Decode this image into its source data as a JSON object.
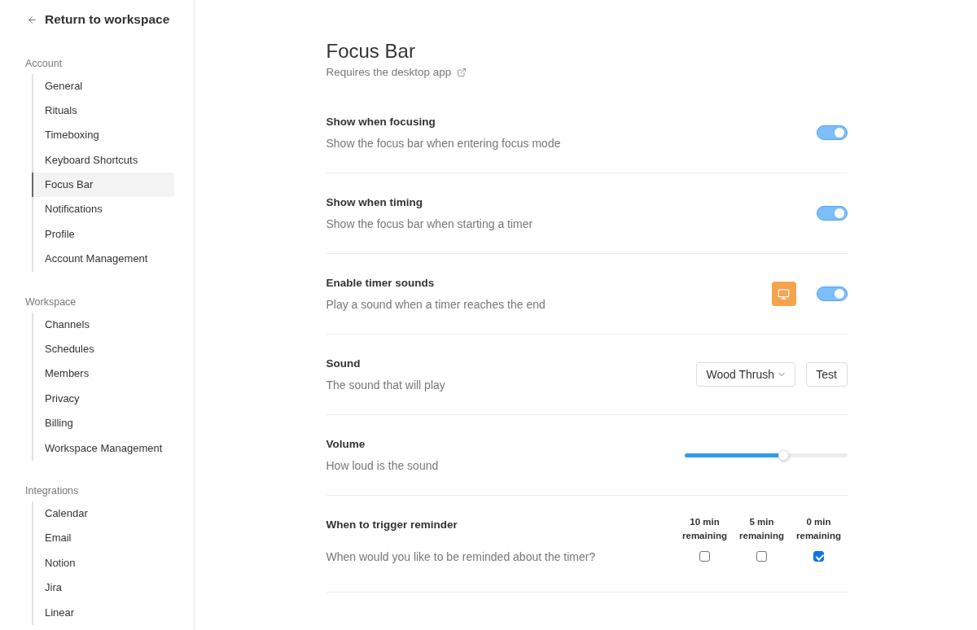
{
  "sidebar": {
    "back_link": "Return to workspace",
    "sections": [
      {
        "title": "Account",
        "items": [
          {
            "label": "General",
            "selected": false
          },
          {
            "label": "Rituals",
            "selected": false
          },
          {
            "label": "Timeboxing",
            "selected": false
          },
          {
            "label": "Keyboard Shortcuts",
            "selected": false
          },
          {
            "label": "Focus Bar",
            "selected": true
          },
          {
            "label": "Notifications",
            "selected": false
          },
          {
            "label": "Profile",
            "selected": false
          },
          {
            "label": "Account Management",
            "selected": false
          }
        ]
      },
      {
        "title": "Workspace",
        "items": [
          {
            "label": "Channels",
            "selected": false
          },
          {
            "label": "Schedules",
            "selected": false
          },
          {
            "label": "Members",
            "selected": false
          },
          {
            "label": "Privacy",
            "selected": false
          },
          {
            "label": "Billing",
            "selected": false
          },
          {
            "label": "Workspace Management",
            "selected": false
          }
        ]
      },
      {
        "title": "Integrations",
        "items": [
          {
            "label": "Calendar",
            "selected": false
          },
          {
            "label": "Email",
            "selected": false
          },
          {
            "label": "Notion",
            "selected": false
          },
          {
            "label": "Jira",
            "selected": false
          },
          {
            "label": "Linear",
            "selected": false
          }
        ]
      }
    ]
  },
  "page": {
    "title": "Focus Bar",
    "subtitle": "Requires the desktop app"
  },
  "settings": [
    {
      "kind": "toggle",
      "title": "Show when focusing",
      "description": "Show the focus bar when entering focus mode",
      "on": true
    },
    {
      "kind": "toggle",
      "title": "Show when timing",
      "description": "Show the focus bar when starting a timer",
      "on": true
    },
    {
      "kind": "toggle",
      "title": "Enable timer sounds",
      "description": "Play a sound when a timer reaches the end",
      "on": true,
      "desktop_badge": true
    },
    {
      "kind": "select",
      "title": "Sound",
      "description": "The sound that will play",
      "value": "Wood Thrush",
      "button": "Test"
    },
    {
      "kind": "slider",
      "title": "Volume",
      "description": "How loud is the sound",
      "level": 0.61
    },
    {
      "kind": "checkboxes",
      "title": "When to trigger reminder",
      "description": "When would you like to be reminded about the timer?",
      "options": [
        {
          "label": "10 min remaining",
          "checked": false
        },
        {
          "label": "5 min remaining",
          "checked": false
        },
        {
          "label": "0 min remaining",
          "checked": true
        }
      ]
    }
  ]
}
